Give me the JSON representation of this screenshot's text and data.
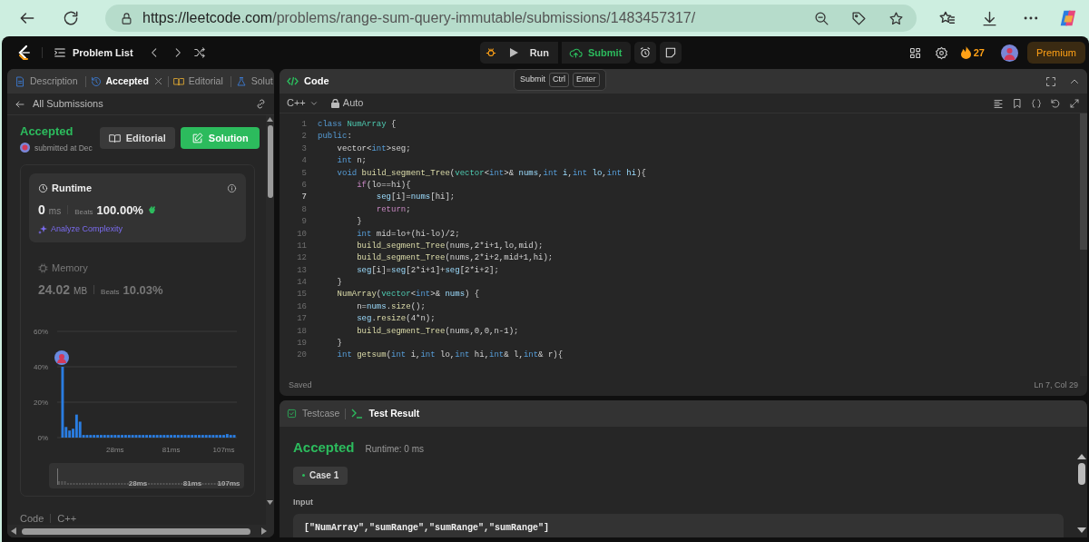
{
  "browser": {
    "url_host": "https://leetcode.com",
    "url_path": "/problems/range-sum-query-immutable/submissions/1483457317/"
  },
  "nav": {
    "problem_list": "Problem List",
    "run": "Run",
    "submit": "Submit",
    "streak": "27",
    "premium": "Premium"
  },
  "tooltip": {
    "label": "Submit",
    "keys": [
      "Ctrl",
      "Enter"
    ]
  },
  "left_tabs": [
    {
      "label": "Description",
      "selected": false,
      "closable": false
    },
    {
      "label": "Accepted",
      "selected": true,
      "closable": true
    },
    {
      "label": "Editorial",
      "selected": false,
      "closable": false
    },
    {
      "label": "Solut",
      "selected": false,
      "closable": false
    }
  ],
  "submission": {
    "back_label": "All Submissions",
    "status": "Accepted",
    "submitted": "submitted at Dec",
    "editorial_button": "Editorial",
    "solution_button": "Solution"
  },
  "metrics": [
    {
      "title": "Runtime",
      "value": "0",
      "unit": "ms",
      "beats_label": "Beats",
      "beats": "100.00%",
      "analyze": "Analyze Complexity",
      "selected": true
    },
    {
      "title": "Memory",
      "value": "24.02",
      "unit": "MB",
      "beats_label": "Beats",
      "beats": "10.03%",
      "selected": false
    }
  ],
  "chart_data": {
    "type": "bar",
    "ylim": [
      0,
      60
    ],
    "yticks": [
      {
        "value": 0,
        "label": "0%"
      },
      {
        "value": 20,
        "label": "20%"
      },
      {
        "value": 40,
        "label": "40%"
      },
      {
        "value": 60,
        "label": "60%"
      }
    ],
    "categories": [
      null,
      null,
      null,
      null,
      null,
      null,
      null,
      null,
      null,
      null,
      null,
      null,
      null,
      null,
      null,
      "28ms",
      null,
      null,
      null,
      null,
      null,
      null,
      null,
      null,
      null,
      null,
      null,
      null,
      null,
      null,
      null,
      "81ms",
      null,
      null,
      null,
      null,
      null,
      null,
      null,
      null,
      null,
      null,
      null,
      null,
      null,
      null,
      "107ms",
      null,
      null,
      null
    ],
    "values": [
      40,
      6,
      4,
      5,
      13,
      9,
      1.5,
      1.5,
      1.5,
      1.5,
      1.5,
      1.5,
      1.5,
      1.5,
      1.5,
      1.5,
      1.5,
      1.5,
      1.5,
      1.5,
      1.5,
      1.5,
      1.5,
      1.5,
      1.5,
      1.5,
      1.5,
      1.5,
      1.5,
      1.5,
      1.5,
      1.5,
      1.5,
      1.5,
      1.5,
      1.5,
      1.5,
      1.5,
      1.5,
      1.5,
      1.5,
      1.5,
      1.5,
      1.5,
      1.5,
      1.5,
      1.5,
      2,
      1.5,
      1.5
    ]
  },
  "brush_labels": [
    "28ms",
    "81ms",
    "107ms"
  ],
  "code_footer": {
    "label": "Code",
    "language": "C++"
  },
  "editor": {
    "title": "Code",
    "language": "C++",
    "mode": "Auto",
    "status": "Saved",
    "cursor": "Ln 7, Col 29",
    "lines": [
      {
        "num": "1",
        "current": false,
        "tokens": [
          {
            "kind": "keyword",
            "text": "class"
          },
          {
            "kind": "type",
            "text": " NumArray"
          },
          {
            "kind": "plain",
            "text": " {"
          }
        ]
      },
      {
        "num": "2",
        "current": false,
        "tokens": [
          {
            "kind": "keyword",
            "text": "public"
          },
          {
            "kind": "plain",
            "text": ":"
          }
        ]
      },
      {
        "num": "3",
        "current": false,
        "tokens": [
          {
            "kind": "plain",
            "text": "    vector<"
          },
          {
            "kind": "keyword",
            "text": "int"
          },
          {
            "kind": "plain",
            "text": ">seg;"
          }
        ]
      },
      {
        "num": "4",
        "current": false,
        "tokens": [
          {
            "kind": "keyword",
            "text": "    int"
          },
          {
            "kind": "plain",
            "text": " n;"
          }
        ]
      },
      {
        "num": "5",
        "current": false,
        "tokens": [
          {
            "kind": "keyword",
            "text": "    void"
          },
          {
            "kind": "function",
            "text": " build_segment_Tree"
          },
          {
            "kind": "plain",
            "text": "("
          },
          {
            "kind": "type",
            "text": "vector"
          },
          {
            "kind": "plain",
            "text": "<"
          },
          {
            "kind": "keyword",
            "text": "int"
          },
          {
            "kind": "plain",
            "text": ">&"
          },
          {
            "kind": "variable",
            "text": " nums"
          },
          {
            "kind": "plain",
            "text": ","
          },
          {
            "kind": "keyword",
            "text": "int"
          },
          {
            "kind": "variable",
            "text": " i"
          },
          {
            "kind": "plain",
            "text": ","
          },
          {
            "kind": "keyword",
            "text": "int"
          },
          {
            "kind": "variable",
            "text": " lo"
          },
          {
            "kind": "plain",
            "text": ","
          },
          {
            "kind": "keyword",
            "text": "int"
          },
          {
            "kind": "variable",
            "text": " hi"
          },
          {
            "kind": "plain",
            "text": "){"
          }
        ]
      },
      {
        "num": "6",
        "current": false,
        "tokens": [
          {
            "kind": "control",
            "text": "        if"
          },
          {
            "kind": "plain",
            "text": "(lo==hi){"
          }
        ]
      },
      {
        "num": "7",
        "current": true,
        "tokens": [
          {
            "kind": "variable",
            "text": "            seg"
          },
          {
            "kind": "plain",
            "text": "[i]="
          },
          {
            "kind": "variable",
            "text": "nums"
          },
          {
            "kind": "plain",
            "text": "[hi];"
          }
        ]
      },
      {
        "num": "8",
        "current": false,
        "tokens": [
          {
            "kind": "control",
            "text": "            return"
          },
          {
            "kind": "plain",
            "text": ";"
          }
        ]
      },
      {
        "num": "9",
        "current": false,
        "tokens": [
          {
            "kind": "plain",
            "text": "        }"
          }
        ]
      },
      {
        "num": "10",
        "current": false,
        "tokens": [
          {
            "kind": "keyword",
            "text": "        int"
          },
          {
            "kind": "plain",
            "text": " mid=lo+(hi-lo)/2;"
          }
        ]
      },
      {
        "num": "11",
        "current": false,
        "tokens": [
          {
            "kind": "function",
            "text": "        build_segment_Tree"
          },
          {
            "kind": "plain",
            "text": "(nums,2*i+1,lo,mid);"
          }
        ]
      },
      {
        "num": "12",
        "current": false,
        "tokens": [
          {
            "kind": "function",
            "text": "        build_segment_Tree"
          },
          {
            "kind": "plain",
            "text": "(nums,2*i+2,mid+1,hi);"
          }
        ]
      },
      {
        "num": "13",
        "current": false,
        "tokens": [
          {
            "kind": "variable",
            "text": "        seg"
          },
          {
            "kind": "plain",
            "text": "[i]="
          },
          {
            "kind": "variable",
            "text": "seg"
          },
          {
            "kind": "plain",
            "text": "[2*i+1]+"
          },
          {
            "kind": "variable",
            "text": "seg"
          },
          {
            "kind": "plain",
            "text": "[2*i+2];"
          }
        ]
      },
      {
        "num": "14",
        "current": false,
        "tokens": [
          {
            "kind": "plain",
            "text": "    }"
          }
        ]
      },
      {
        "num": "15",
        "current": false,
        "tokens": [
          {
            "kind": "function",
            "text": "    NumArray"
          },
          {
            "kind": "plain",
            "text": "("
          },
          {
            "kind": "type",
            "text": "vector"
          },
          {
            "kind": "plain",
            "text": "<"
          },
          {
            "kind": "keyword",
            "text": "int"
          },
          {
            "kind": "plain",
            "text": ">&"
          },
          {
            "kind": "variable",
            "text": " nums"
          },
          {
            "kind": "plain",
            "text": ") {"
          }
        ]
      },
      {
        "num": "16",
        "current": false,
        "tokens": [
          {
            "kind": "plain",
            "text": "        n="
          },
          {
            "kind": "variable",
            "text": "nums"
          },
          {
            "kind": "plain",
            "text": "."
          },
          {
            "kind": "function",
            "text": "size"
          },
          {
            "kind": "plain",
            "text": "();"
          }
        ]
      },
      {
        "num": "17",
        "current": false,
        "tokens": [
          {
            "kind": "variable",
            "text": "        seg"
          },
          {
            "kind": "plain",
            "text": "."
          },
          {
            "kind": "function",
            "text": "resize"
          },
          {
            "kind": "plain",
            "text": "(4*n);"
          }
        ]
      },
      {
        "num": "18",
        "current": false,
        "tokens": [
          {
            "kind": "function",
            "text": "        build_segment_Tree"
          },
          {
            "kind": "plain",
            "text": "(nums,0,0,n-1);"
          }
        ]
      },
      {
        "num": "19",
        "current": false,
        "tokens": [
          {
            "kind": "plain",
            "text": "    }"
          }
        ]
      },
      {
        "num": "20",
        "current": false,
        "tokens": [
          {
            "kind": "keyword",
            "text": "    int"
          },
          {
            "kind": "function",
            "text": " getsum"
          },
          {
            "kind": "plain",
            "text": "("
          },
          {
            "kind": "keyword",
            "text": "int"
          },
          {
            "kind": "plain",
            "text": " i,"
          },
          {
            "kind": "keyword",
            "text": "int"
          },
          {
            "kind": "plain",
            "text": " lo,"
          },
          {
            "kind": "keyword",
            "text": "int"
          },
          {
            "kind": "plain",
            "text": " hi,"
          },
          {
            "kind": "keyword",
            "text": "int"
          },
          {
            "kind": "plain",
            "text": "& l,"
          },
          {
            "kind": "keyword",
            "text": "int"
          },
          {
            "kind": "plain",
            "text": "& r){"
          }
        ]
      }
    ]
  },
  "result_tabs": [
    {
      "label": "Testcase",
      "selected": false
    },
    {
      "label": "Test Result",
      "selected": true
    }
  ],
  "result": {
    "status": "Accepted",
    "runtime": "Runtime: 0 ms",
    "cases": [
      {
        "label": "Case 1",
        "selected": true
      }
    ],
    "input_label": "Input",
    "input_value": "[\"NumArray\",\"sumRange\",\"sumRange\",\"sumRange\"]"
  }
}
